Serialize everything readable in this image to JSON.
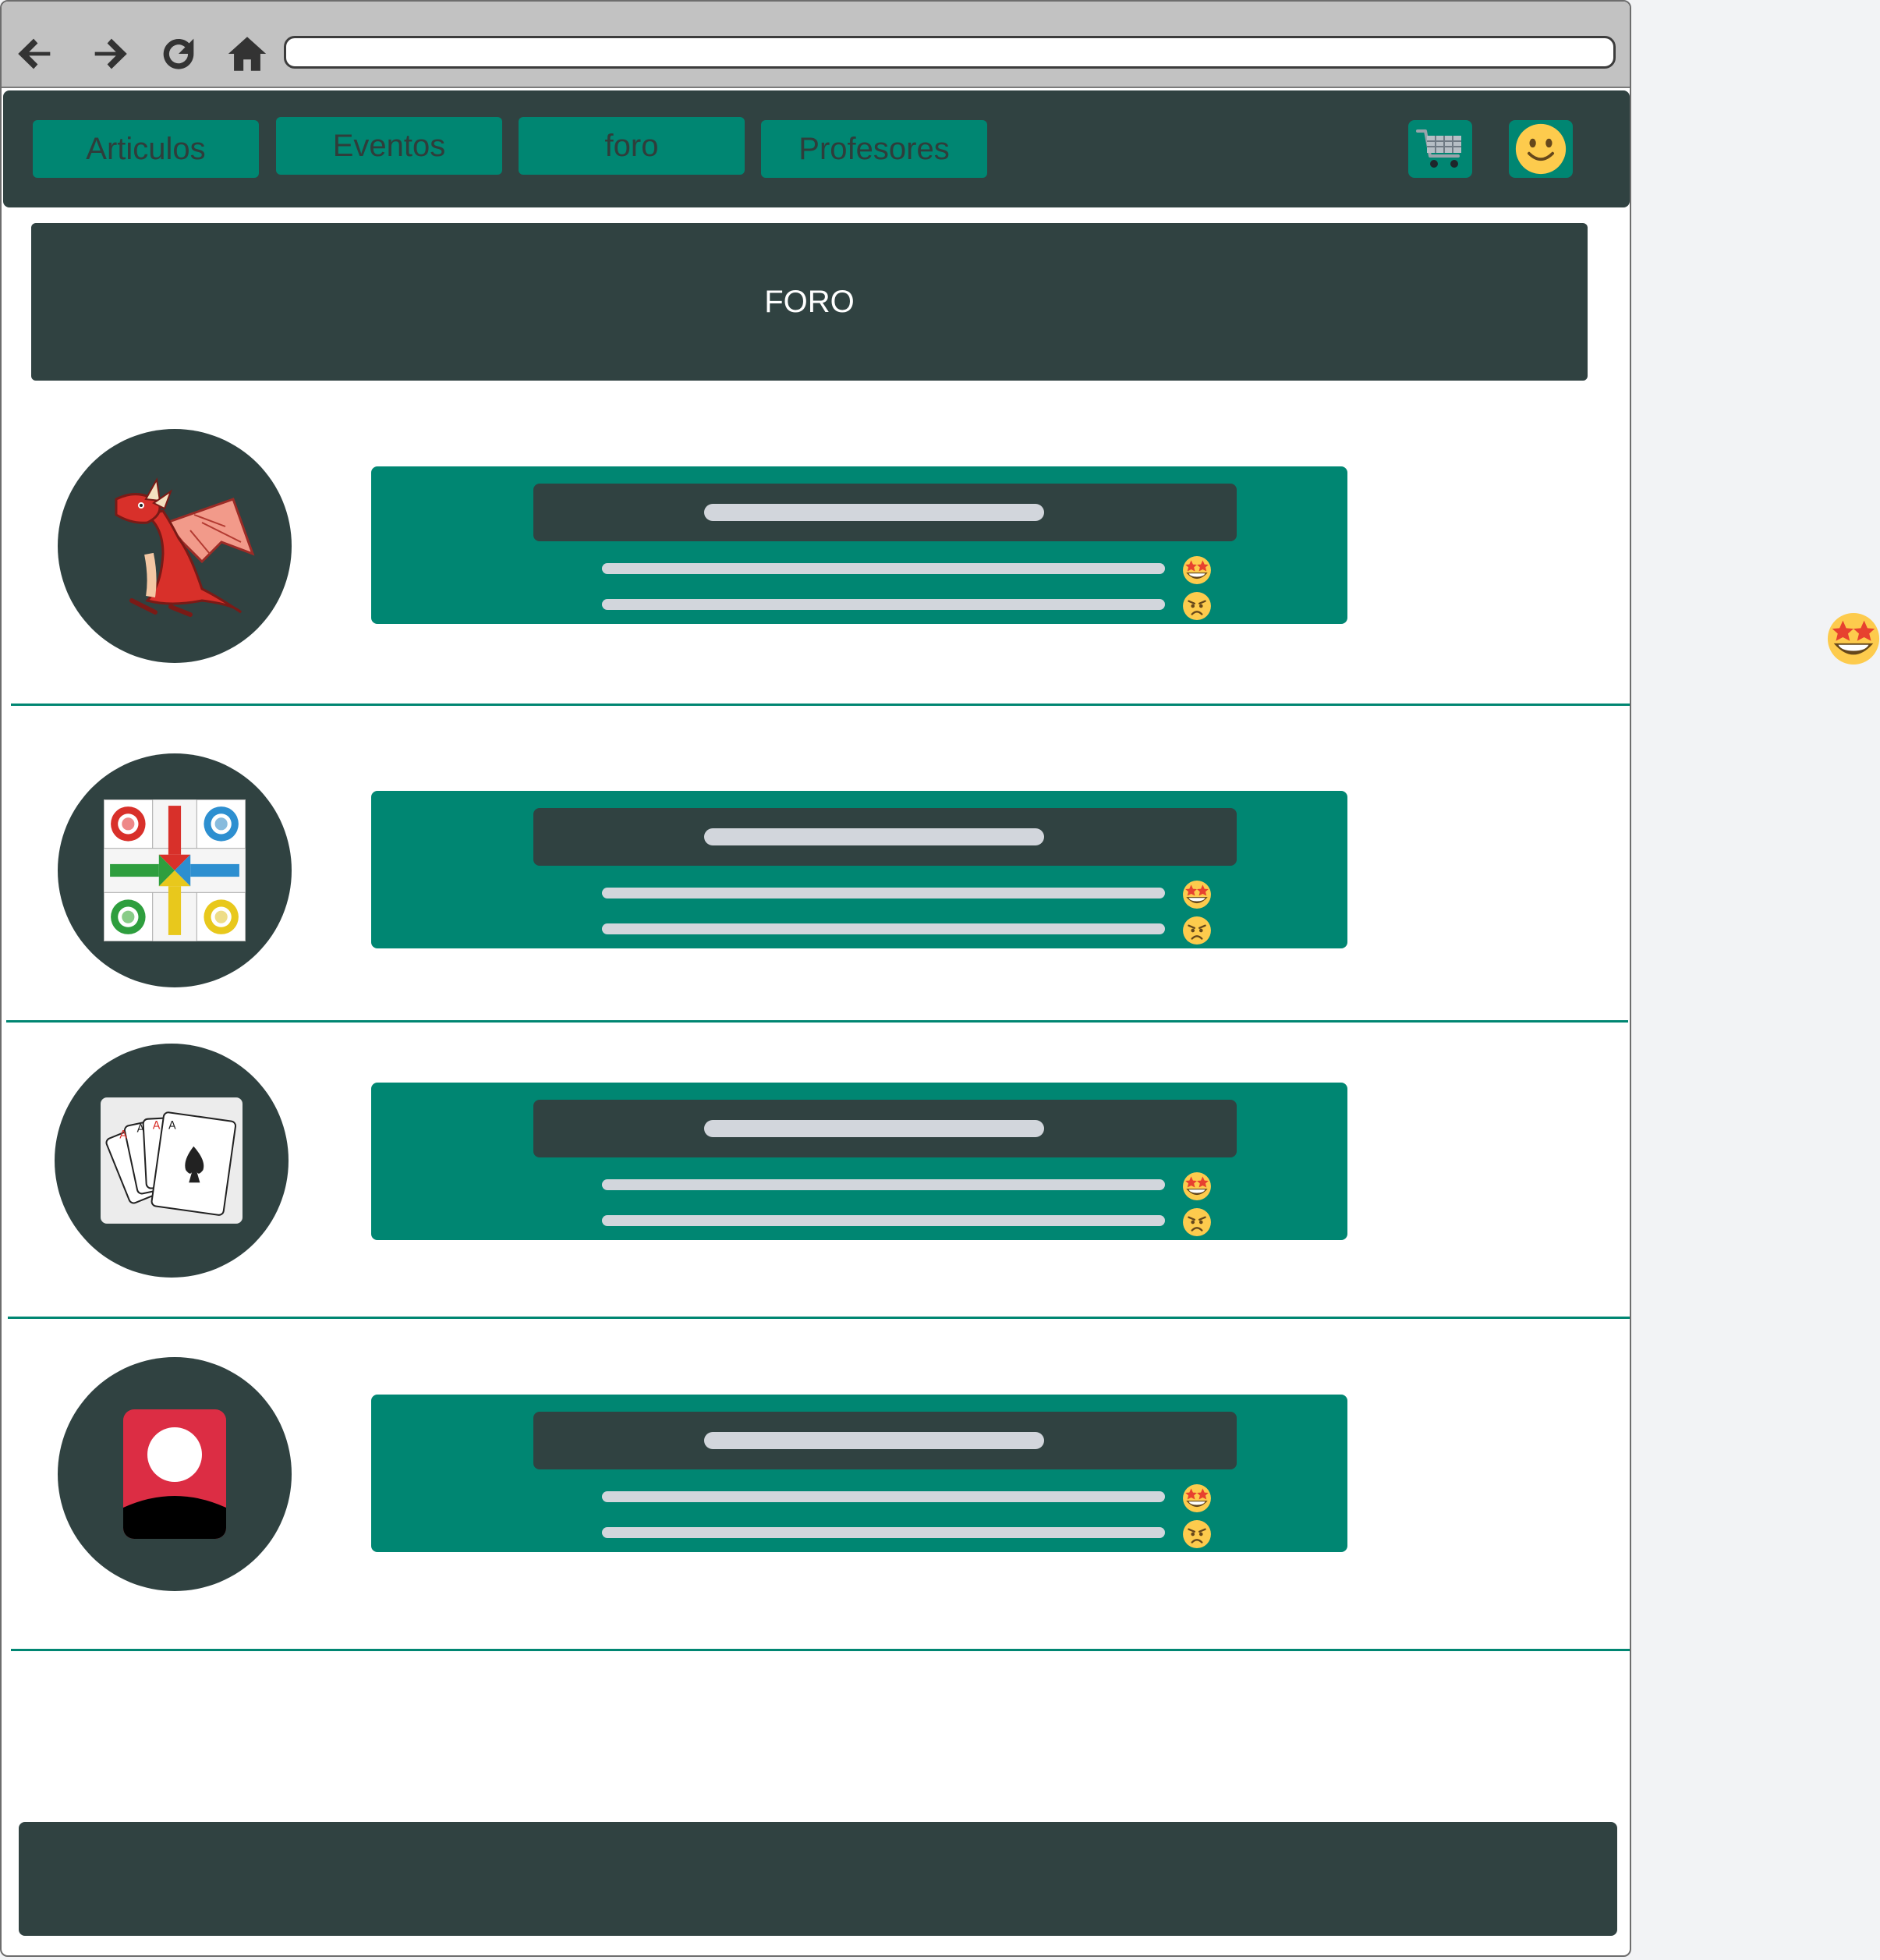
{
  "nav": {
    "items": [
      {
        "label": "Articulos"
      },
      {
        "label": "Eventos"
      },
      {
        "label": "foro"
      },
      {
        "label": "Profesores"
      }
    ]
  },
  "banner": {
    "title": "FORO"
  },
  "posts": [
    {
      "avatar_icon": "dragon-icon"
    },
    {
      "avatar_icon": "parchis-board-icon"
    },
    {
      "avatar_icon": "playing-cards-icon"
    },
    {
      "avatar_icon": "user-profile-icon"
    }
  ],
  "reactions": [
    "star-struck-emoji",
    "angry-emoji"
  ],
  "colors": {
    "dark": "#304241",
    "accent": "#008672",
    "placeholder": "#d2d6dc",
    "chrome": "#c2c2c2"
  }
}
